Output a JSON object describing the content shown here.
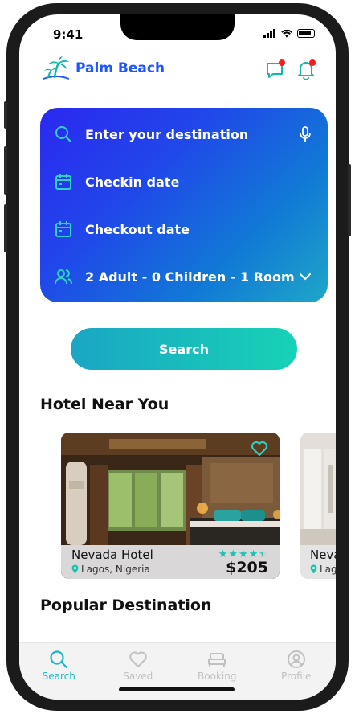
{
  "status": {
    "time": "9:41"
  },
  "header": {
    "app_name": "Palm Beach",
    "message_icon": "chat-bubble-icon",
    "bell_icon": "bell-icon"
  },
  "search_card": {
    "destination_placeholder": "Enter your destination",
    "checkin_placeholder": "Checkin date",
    "checkout_placeholder": "Checkout date",
    "guests_value": "2 Adult - 0 Children - 1 Room"
  },
  "search_button": {
    "label": "Search"
  },
  "hotels_section": {
    "title": "Hotel Near You"
  },
  "hotels": [
    {
      "name": "Nevada Hotel",
      "location": "Lagos, Nigeria",
      "price": "$205",
      "rating": 4.5
    },
    {
      "name": "Nevada",
      "location": "Lag"
    }
  ],
  "popular_section": {
    "title": "Popular Destination"
  },
  "tabs": [
    {
      "label": "Search",
      "icon": "search-icon",
      "active": true
    },
    {
      "label": "Saved",
      "icon": "heart-icon",
      "active": false
    },
    {
      "label": "Booking",
      "icon": "bed-icon",
      "active": false
    },
    {
      "label": "Profile",
      "icon": "user-icon",
      "active": false
    }
  ],
  "colors": {
    "accent": "#1ab8c4",
    "brand": "#1e56ff",
    "card_start": "#2b28f0",
    "card_end": "#1ea7c7"
  }
}
